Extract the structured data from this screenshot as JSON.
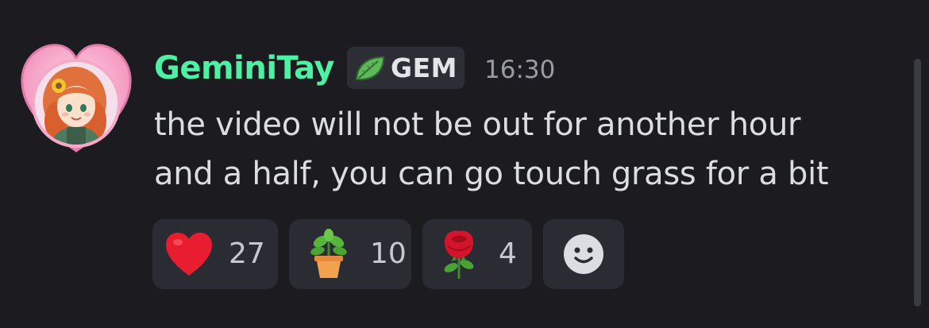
{
  "message": {
    "author": "GeminiTay",
    "tag": {
      "label": "GEM",
      "icon": "leaf-icon"
    },
    "timestamp": "16:30",
    "lines": [
      "the video will not be out for another hour",
      "and a half, you can go touch grass for a bit"
    ],
    "reactions": [
      {
        "emoji": "heart",
        "count": "27"
      },
      {
        "emoji": "potted-plant",
        "count": "10"
      },
      {
        "emoji": "rose",
        "count": "4"
      }
    ],
    "add_reaction_icon": "smiley-icon"
  },
  "colors": {
    "background": "#1b1b20",
    "username": "#4ef0a4",
    "text": "#dbdde1",
    "timestamp": "#9a9ca4",
    "reaction_bg": "#2b2c33"
  }
}
